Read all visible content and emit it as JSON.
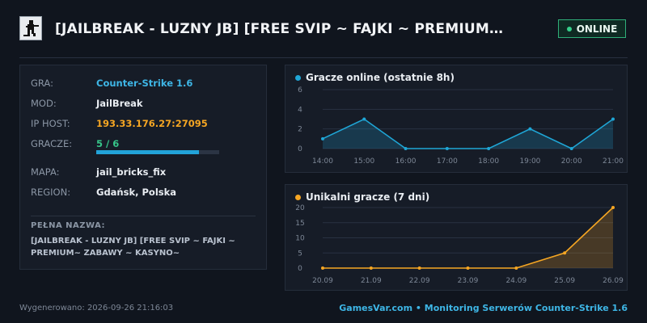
{
  "header": {
    "icon": "counter-strike-player-icon",
    "title": "[JAILBREAK - LUZNY JB] [FREE SVIP ~ FAJKI ~ PREMIUM~ ZABAWY ~ KASYNO~",
    "status": "ONLINE",
    "status_color": "#35d18b"
  },
  "info": {
    "rows": [
      {
        "label": "GRA:",
        "value": "Counter-Strike 1.6"
      },
      {
        "label": "MOD:",
        "value": "JailBreak"
      },
      {
        "label": "IP HOST:",
        "value": "193.33.176.27:27095"
      },
      {
        "label": "GRACZE:",
        "value": "5 / 6"
      },
      {
        "label": "MAPA:",
        "value": "jail_bricks_fix"
      },
      {
        "label": "REGION:",
        "value": "Gdańsk, Polska"
      }
    ],
    "players_fill": 0.8333,
    "fullname_label": "PEŁNA NAZWA:",
    "fullname": "[JAILBREAK - LUZNY JB] [FREE SVIP ~ FAJKI ~ PREMIUM~ ZABAWY ~ KASYNO~"
  },
  "chart_data": [
    {
      "type": "area",
      "title": "Gracze online (ostatnie 8h)",
      "color": "#1fa6d6",
      "x": [
        "14:00",
        "15:00",
        "16:00",
        "17:00",
        "18:00",
        "19:00",
        "20:00",
        "21:00"
      ],
      "values": [
        1,
        3,
        0,
        0,
        0,
        2,
        0,
        3
      ],
      "yticks": [
        0,
        2,
        4,
        6
      ],
      "ylim": [
        0,
        6
      ],
      "grid": true
    },
    {
      "type": "area",
      "title": "Unikalni gracze (7 dni)",
      "color": "#f5a623",
      "x": [
        "20.09",
        "21.09",
        "22.09",
        "23.09",
        "24.09",
        "25.09",
        "26.09"
      ],
      "values": [
        0,
        0,
        0,
        0,
        0,
        5,
        20
      ],
      "yticks": [
        0,
        5,
        10,
        15,
        20
      ],
      "ylim": [
        0,
        20
      ],
      "grid": true
    }
  ],
  "footer": {
    "generated": "Wygenerowano: 2026-09-26 21:16:03",
    "brand": "GamesVar.com • Monitoring Serwerów Counter-Strike 1.6"
  }
}
